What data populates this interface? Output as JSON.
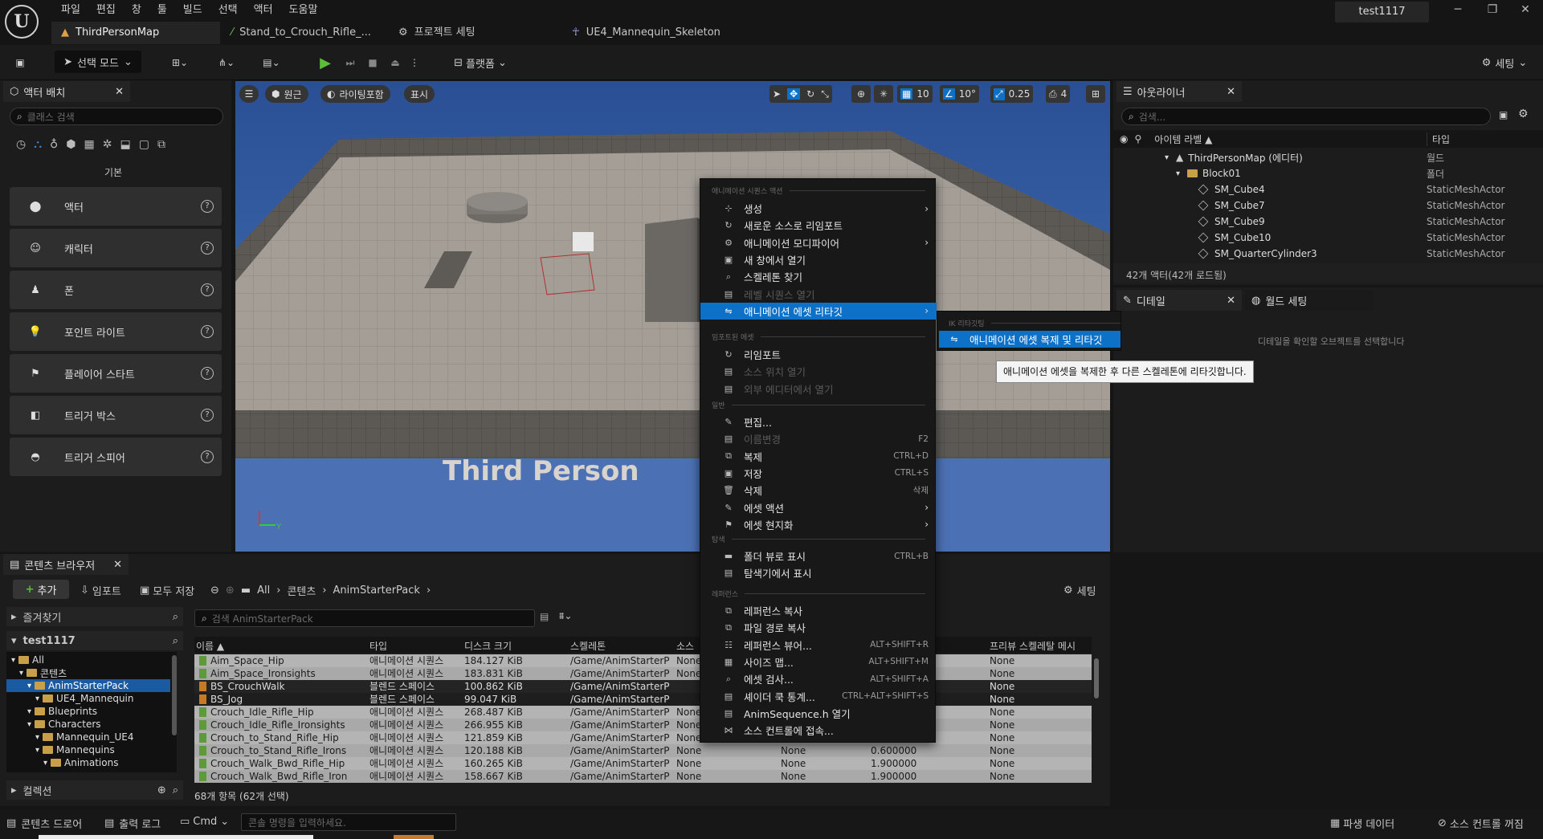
{
  "menubar": [
    "파일",
    "편집",
    "창",
    "툴",
    "빌드",
    "선택",
    "액터",
    "도움말"
  ],
  "user": "test1117",
  "tabs": [
    "ThirdPersonMap",
    "Stand_to_Crouch_Rifle_...",
    "프로젝트 세팅",
    "UE4_Mannequin_Skeleton"
  ],
  "toolbar": {
    "mode": "선택 모드",
    "platforms": "플랫폼",
    "settings": "세팅"
  },
  "place_actors": {
    "title": "액터 배치",
    "search_placeholder": "클래스 검색",
    "category": "기본",
    "items": [
      "액터",
      "캐릭터",
      "폰",
      "포인트 라이트",
      "플레이어 스타트",
      "트리거 박스",
      "트리거 스피어"
    ]
  },
  "viewport": {
    "perspective": "원근",
    "lighting": "라이팅포함",
    "show": "표시",
    "grid": "10",
    "angle": "10°",
    "scale": "0.25",
    "camera": "4",
    "overlay_text": "Third Person",
    "axis_y": "Y"
  },
  "context_menu": {
    "section1": "애니메이션 시퀀스 액션",
    "items1": [
      {
        "label": "생성",
        "arrow": true
      },
      {
        "label": "새로운 소스로 리임포트"
      },
      {
        "label": "애니메이션 모디파이어",
        "arrow": true
      },
      {
        "label": "새 창에서 열기"
      },
      {
        "label": "스켈레톤 찾기"
      },
      {
        "label": "레벨 시퀀스 열기",
        "disabled": true
      },
      {
        "label": "애니메이션 에셋 리타깃",
        "arrow": true,
        "highlight": true
      }
    ],
    "section2": "임포트된 에셋",
    "items2": [
      {
        "label": "리임포트"
      },
      {
        "label": "소스 위치 열기",
        "disabled": true
      },
      {
        "label": "외부 에디터에서 열기",
        "disabled": true
      }
    ],
    "section3": "일반",
    "items3": [
      {
        "label": "편집..."
      },
      {
        "label": "이름변경",
        "shortcut": "F2",
        "disabled": true
      },
      {
        "label": "복제",
        "shortcut": "CTRL+D"
      },
      {
        "label": "저장",
        "shortcut": "CTRL+S"
      },
      {
        "label": "삭제",
        "shortcut": "삭제"
      },
      {
        "label": "에셋 액션",
        "arrow": true
      },
      {
        "label": "에셋 현지화",
        "arrow": true
      }
    ],
    "section4": "탐색",
    "items4": [
      {
        "label": "폴더 뷰로 표시",
        "shortcut": "CTRL+B"
      },
      {
        "label": "탐색기에서 표시"
      }
    ],
    "section5": "레퍼런스",
    "items5": [
      {
        "label": "레퍼런스 복사"
      },
      {
        "label": "파일 경로 복사"
      },
      {
        "label": "레퍼런스 뷰어...",
        "shortcut": "ALT+SHIFT+R"
      },
      {
        "label": "사이즈 맵...",
        "shortcut": "ALT+SHIFT+M"
      },
      {
        "label": "에셋 검사...",
        "shortcut": "ALT+SHIFT+A"
      },
      {
        "label": "셰이더 쿡 통계...",
        "shortcut": "CTRL+ALT+SHIFT+S"
      },
      {
        "label": "AnimSequence.h 열기"
      },
      {
        "label": "소스 컨트롤에 접속..."
      }
    ]
  },
  "submenu": {
    "section": "IK 리타깃팅",
    "item": "애니메이션 에셋 복제 및 리타깃"
  },
  "tooltip": "애니메이션 에셋을 복제한 후 다른 스켈레톤에 리타깃합니다.",
  "outliner": {
    "title": "아웃라이너",
    "search_placeholder": "검색...",
    "col_label": "아이템 라벨 ▲",
    "col_type": "타입",
    "rows": [
      {
        "name": "ThirdPersonMap (에디터)",
        "type": "월드",
        "indent": 0
      },
      {
        "name": "Block01",
        "type": "폴더",
        "indent": 1
      },
      {
        "name": "SM_Cube4",
        "type": "StaticMeshActor",
        "indent": 2
      },
      {
        "name": "SM_Cube7",
        "type": "StaticMeshActor",
        "indent": 2
      },
      {
        "name": "SM_Cube9",
        "type": "StaticMeshActor",
        "indent": 2
      },
      {
        "name": "SM_Cube10",
        "type": "StaticMeshActor",
        "indent": 2
      },
      {
        "name": "SM_QuarterCylinder3",
        "type": "StaticMeshActor",
        "indent": 2
      }
    ],
    "status": "42개 액터(42개 로드됨)"
  },
  "details": {
    "title": "디테일",
    "world_settings": "월드 세팅",
    "empty": "디테일을 확인할 오브젝트를 선택합니다"
  },
  "content_browser": {
    "title": "콘텐츠 브라우저",
    "add": "추가",
    "import": "임포트",
    "save_all": "모두 저장",
    "path": [
      "All",
      "콘텐츠",
      "AnimStarterPack"
    ],
    "settings": "세팅",
    "favorites": "즐겨찾기",
    "project": "test1117",
    "collections": "컬렉션",
    "search_placeholder": "검색 AnimStarterPack",
    "tree": [
      {
        "label": "All",
        "indent": 0
      },
      {
        "label": "콘텐츠",
        "indent": 1
      },
      {
        "label": "AnimStarterPack",
        "indent": 2,
        "selected": true
      },
      {
        "label": "UE4_Mannequin",
        "indent": 3
      },
      {
        "label": "Blueprints",
        "indent": 2
      },
      {
        "label": "Characters",
        "indent": 2
      },
      {
        "label": "Mannequin_UE4",
        "indent": 3
      },
      {
        "label": "Mannequins",
        "indent": 3
      },
      {
        "label": "Animations",
        "indent": 4
      }
    ],
    "columns": [
      "이름 ▲",
      "타입",
      "디스크 크기",
      "스켈레톤",
      "소스",
      "",
      "",
      "프리뷰 스켈레탈 메시"
    ],
    "rows": [
      {
        "name": "Aim_Space_Hip",
        "type": "애니메이션 시퀀스",
        "size": "184.127 KiB",
        "skel": "/Game/AnimStarterP",
        "src": "None",
        "c6": "",
        "c7": "",
        "prev": "None",
        "sel": true
      },
      {
        "name": "Aim_Space_Ironsights",
        "type": "애니메이션 시퀀스",
        "size": "183.831 KiB",
        "skel": "/Game/AnimStarterP",
        "src": "None",
        "c6": "",
        "c7": "",
        "prev": "None",
        "sel": true
      },
      {
        "name": "BS_CrouchWalk",
        "type": "블렌드 스페이스",
        "size": "100.862 KiB",
        "skel": "/Game/AnimStarterP",
        "src": "",
        "c6": "",
        "c7": "",
        "prev": "None",
        "sel": false
      },
      {
        "name": "BS_Jog",
        "type": "블렌드 스페이스",
        "size": "99.047 KiB",
        "skel": "/Game/AnimStarterP",
        "src": "",
        "c6": "",
        "c7": "",
        "prev": "None",
        "sel": false
      },
      {
        "name": "Crouch_Idle_Rifle_Hip",
        "type": "애니메이션 시퀀스",
        "size": "268.487 KiB",
        "skel": "/Game/AnimStarterP",
        "src": "None",
        "c6": "",
        "c7": "",
        "prev": "None",
        "sel": true
      },
      {
        "name": "Crouch_Idle_Rifle_Ironsights",
        "type": "애니메이션 시퀀스",
        "size": "266.955 KiB",
        "skel": "/Game/AnimStarterP",
        "src": "None",
        "c6": "",
        "c7": "",
        "prev": "None",
        "sel": true
      },
      {
        "name": "Crouch_to_Stand_Rifle_Hip",
        "type": "애니메이션 시퀀스",
        "size": "121.859 KiB",
        "skel": "/Game/AnimStarterP",
        "src": "None",
        "c6": "",
        "c7": "",
        "prev": "None",
        "sel": true
      },
      {
        "name": "Crouch_to_Stand_Rifle_Ironsights",
        "type": "애니메이션 시퀀스",
        "size": "120.188 KiB",
        "skel": "/Game/AnimStarterP",
        "src": "None",
        "c6": "None",
        "c7": "0.600000",
        "prev": "None",
        "sel": true
      },
      {
        "name": "Crouch_Walk_Bwd_Rifle_Hip",
        "type": "애니메이션 시퀀스",
        "size": "160.265 KiB",
        "skel": "/Game/AnimStarterP",
        "src": "None",
        "c6": "None",
        "c7": "1.900000",
        "prev": "None",
        "sel": true
      },
      {
        "name": "Crouch_Walk_Bwd_Rifle_Ironsights",
        "type": "애니메이션 시퀀스",
        "size": "158.667 KiB",
        "skel": "/Game/AnimStarterP",
        "src": "None",
        "c6": "None",
        "c7": "1.900000",
        "prev": "None",
        "sel": true
      }
    ],
    "status": "68개 항목 (62개 선택)"
  },
  "bottombar": {
    "drawer": "콘텐츠 드로어",
    "output_log": "출력 로그",
    "cmd": "Cmd",
    "cmd_placeholder": "콘솔 명령을 입력하세요.",
    "derived_data": "파생 데이터",
    "source_control": "소스 컨트롤 꺼짐"
  }
}
